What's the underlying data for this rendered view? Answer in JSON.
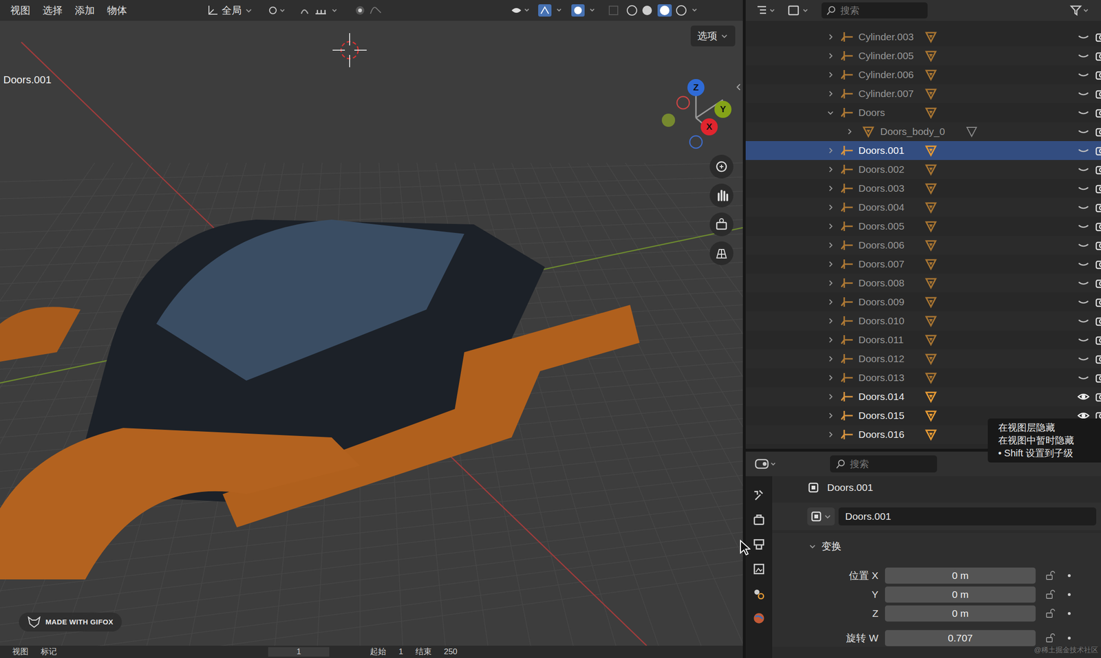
{
  "viewport": {
    "menus": [
      "视图",
      "选择",
      "添加",
      "物体"
    ],
    "orientation": "全局",
    "options_button": "选项",
    "object_label": "Doors.001",
    "gizmo": {
      "z": "Z",
      "y": "Y",
      "x": "X"
    },
    "watermark": "MADE WITH GIFOX",
    "timeline": [
      "视图",
      "标记",
      "1",
      "起始",
      "1",
      "结束",
      "250"
    ]
  },
  "outliner": {
    "search": {
      "placeholder": "搜索"
    },
    "rows": [
      {
        "label": "Cylinder.003",
        "depth": 0,
        "kind": "object",
        "expanded": false,
        "selected": false,
        "visible": false
      },
      {
        "label": "Cylinder.005",
        "depth": 0,
        "kind": "object",
        "expanded": false,
        "selected": false,
        "visible": false
      },
      {
        "label": "Cylinder.006",
        "depth": 0,
        "kind": "object",
        "expanded": false,
        "selected": false,
        "visible": false
      },
      {
        "label": "Cylinder.007",
        "depth": 0,
        "kind": "object",
        "expanded": false,
        "selected": false,
        "visible": false
      },
      {
        "label": "Doors",
        "depth": 0,
        "kind": "object",
        "expanded": true,
        "selected": false,
        "visible": false
      },
      {
        "label": "Doors_body_0",
        "depth": 1,
        "kind": "mesh",
        "expanded": false,
        "selected": false,
        "visible": false
      },
      {
        "label": "Doors.001",
        "depth": 0,
        "kind": "object",
        "expanded": false,
        "selected": true,
        "visible": false
      },
      {
        "label": "Doors.002",
        "depth": 0,
        "kind": "object",
        "expanded": false,
        "selected": false,
        "visible": false
      },
      {
        "label": "Doors.003",
        "depth": 0,
        "kind": "object",
        "expanded": false,
        "selected": false,
        "visible": false
      },
      {
        "label": "Doors.004",
        "depth": 0,
        "kind": "object",
        "expanded": false,
        "selected": false,
        "visible": false
      },
      {
        "label": "Doors.005",
        "depth": 0,
        "kind": "object",
        "expanded": false,
        "selected": false,
        "visible": false
      },
      {
        "label": "Doors.006",
        "depth": 0,
        "kind": "object",
        "expanded": false,
        "selected": false,
        "visible": false
      },
      {
        "label": "Doors.007",
        "depth": 0,
        "kind": "object",
        "expanded": false,
        "selected": false,
        "visible": false
      },
      {
        "label": "Doors.008",
        "depth": 0,
        "kind": "object",
        "expanded": false,
        "selected": false,
        "visible": false
      },
      {
        "label": "Doors.009",
        "depth": 0,
        "kind": "object",
        "expanded": false,
        "selected": false,
        "visible": false
      },
      {
        "label": "Doors.010",
        "depth": 0,
        "kind": "object",
        "expanded": false,
        "selected": false,
        "visible": false
      },
      {
        "label": "Doors.011",
        "depth": 0,
        "kind": "object",
        "expanded": false,
        "selected": false,
        "visible": false
      },
      {
        "label": "Doors.012",
        "depth": 0,
        "kind": "object",
        "expanded": false,
        "selected": false,
        "visible": false
      },
      {
        "label": "Doors.013",
        "depth": 0,
        "kind": "object",
        "expanded": false,
        "selected": false,
        "visible": false
      },
      {
        "label": "Doors.014",
        "depth": 0,
        "kind": "object",
        "expanded": false,
        "selected": false,
        "visible": true
      },
      {
        "label": "Doors.015",
        "depth": 0,
        "kind": "object",
        "expanded": false,
        "selected": false,
        "visible": true
      },
      {
        "label": "Doors.016",
        "depth": 0,
        "kind": "object",
        "expanded": false,
        "selected": false,
        "visible": true
      }
    ]
  },
  "tooltip": [
    "在视图层隐藏",
    "在视图中暂时隐藏",
    "• Shift 设置到子级"
  ],
  "properties": {
    "search": {
      "placeholder": "搜索"
    },
    "title": "Doors.001",
    "name_field": "Doors.001",
    "section": {
      "label": "变换",
      "expanded": true
    },
    "fields": [
      {
        "label": "位置 X",
        "value": "0 m"
      },
      {
        "label": "Y",
        "value": "0 m"
      },
      {
        "label": "Z",
        "value": "0 m"
      },
      {
        "label": "旋转 W",
        "value": "0.707"
      }
    ]
  },
  "page_watermark": "@稀土掘金技术社区"
}
